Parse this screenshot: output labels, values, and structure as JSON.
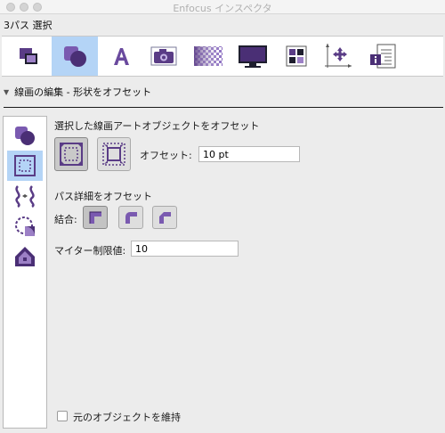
{
  "window": {
    "title": "Enfocus インスペクタ"
  },
  "selection": {
    "label": "3パス 選択"
  },
  "toolbar": {
    "active_index": 1,
    "items": [
      {
        "icon": "objects-icon"
      },
      {
        "icon": "shapes-icon"
      },
      {
        "icon": "text-icon"
      },
      {
        "icon": "image-icon"
      },
      {
        "icon": "transparency-icon"
      },
      {
        "icon": "display-icon"
      },
      {
        "icon": "colors-icon"
      },
      {
        "icon": "position-icon"
      },
      {
        "icon": "info-icon"
      }
    ]
  },
  "section": {
    "title": "線画の編集 - 形状をオフセット"
  },
  "side": {
    "active_index": 1,
    "items": [
      {
        "icon": "edit-shape-icon"
      },
      {
        "icon": "offset-shape-icon"
      },
      {
        "icon": "wave-path-icon"
      },
      {
        "icon": "round-corners-icon"
      },
      {
        "icon": "house-shape-icon"
      }
    ]
  },
  "offset": {
    "title": "選択した線画アートオブジェクトをオフセット",
    "label": "オフセット:",
    "value": "10 pt",
    "selected_mode": "outward"
  },
  "path_detail": {
    "title": "パス詳細をオフセット",
    "join_label": "結合:",
    "selected_join": "miter",
    "joins": [
      "miter",
      "round",
      "bevel"
    ],
    "miter_label": "マイター制限値:",
    "miter_value": "10"
  },
  "keep_original": {
    "label": "元のオブジェクトを維持",
    "checked": false
  },
  "colors": {
    "accent": "#b4d4f6",
    "icon_purple": "#5a3c86",
    "icon_light": "#9c80c6"
  }
}
